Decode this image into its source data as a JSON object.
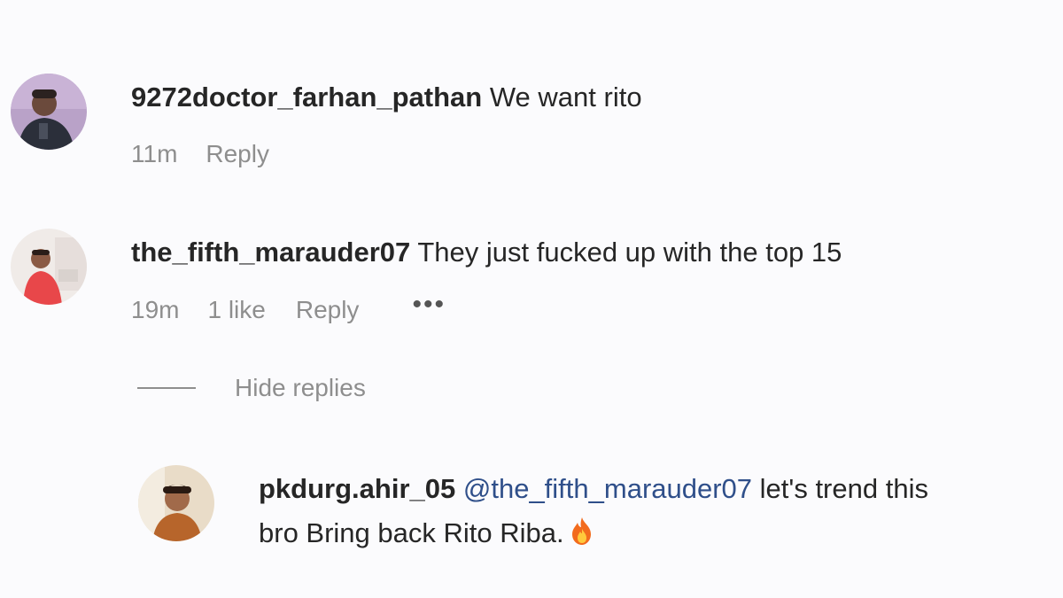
{
  "comments": [
    {
      "username": "9272doctor_farhan_pathan",
      "text": "We want rito",
      "time": "11m",
      "reply_label": "Reply"
    },
    {
      "username": "the_fifth_marauder07",
      "text": "They just fucked up with the top 15",
      "time": "19m",
      "likes": "1 like",
      "reply_label": "Reply",
      "more_icon": "•••"
    }
  ],
  "hide_replies_label": "Hide replies",
  "reply": {
    "username": "pkdurg.ahir_05",
    "mention": "@the_fifth_marauder07",
    "text_line1": "let's trend this",
    "text_line2": "bro Bring back Rito Riba.",
    "emoji": "fire-emoji"
  },
  "colors": {
    "background": "#fbfbfd",
    "username": "#262626",
    "meta": "#8e8e8e",
    "mention": "#2f4f8a"
  }
}
